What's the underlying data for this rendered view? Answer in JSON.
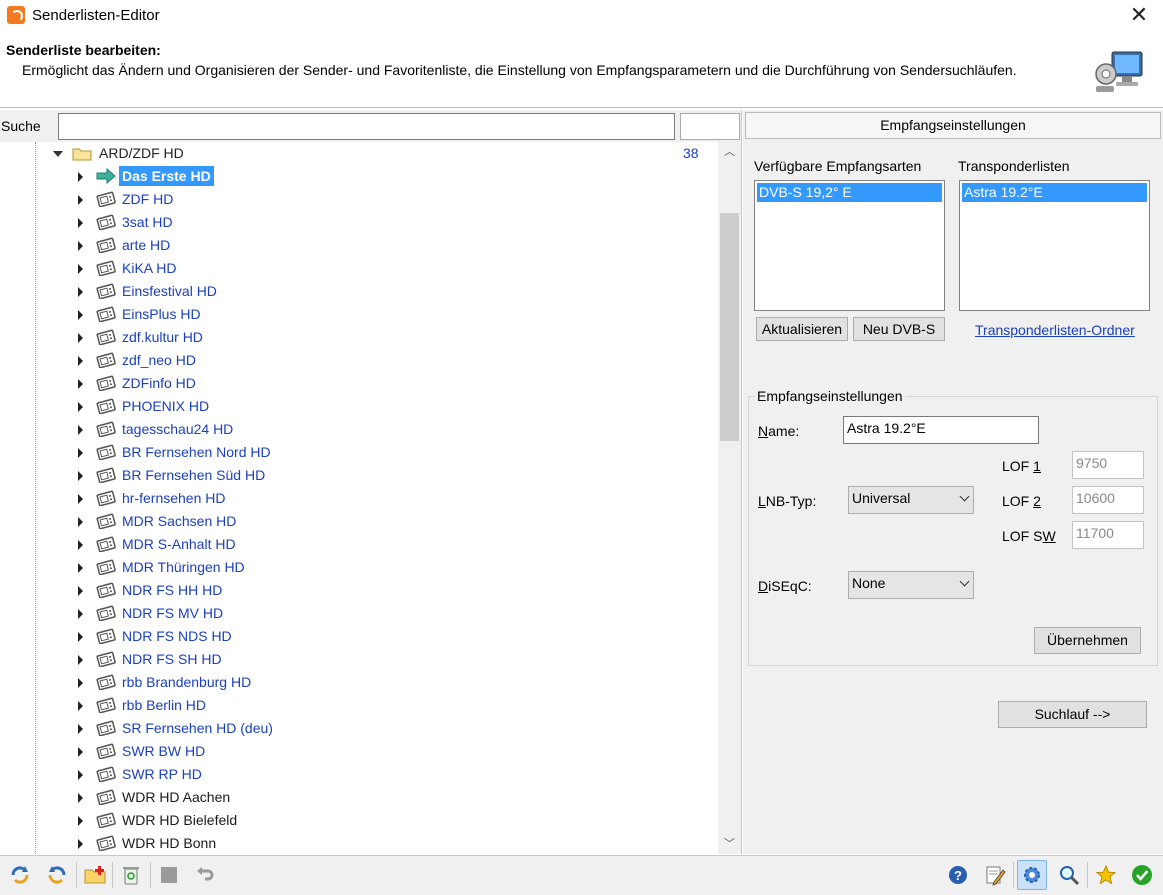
{
  "window": {
    "title": "Senderlisten-Editor",
    "close": "✕"
  },
  "header": {
    "title": "Senderliste bearbeiten:",
    "description": "Ermöglicht das Ändern und Organisieren der Sender- und Favoritenliste, die Einstellung von Empfangsparametern und die Durchführung von Sendersuchläufen."
  },
  "search": {
    "label": "Suche",
    "value": ""
  },
  "tree": {
    "folder": {
      "label": "ARD/ZDF HD",
      "count": "38"
    },
    "channels": [
      {
        "label": "Das Erste HD",
        "selected": true,
        "color": "blue"
      },
      {
        "label": "ZDF HD",
        "color": "blue"
      },
      {
        "label": "3sat HD",
        "color": "blue"
      },
      {
        "label": "arte HD",
        "color": "blue"
      },
      {
        "label": "KiKA HD",
        "color": "blue"
      },
      {
        "label": "Einsfestival HD",
        "color": "blue"
      },
      {
        "label": "EinsPlus HD",
        "color": "blue"
      },
      {
        "label": "zdf.kultur HD",
        "color": "blue"
      },
      {
        "label": "zdf_neo HD",
        "color": "blue"
      },
      {
        "label": "ZDFinfo HD",
        "color": "blue"
      },
      {
        "label": "PHOENIX HD",
        "color": "blue"
      },
      {
        "label": "tagesschau24 HD",
        "color": "blue"
      },
      {
        "label": "BR Fernsehen Nord HD",
        "color": "blue"
      },
      {
        "label": "BR Fernsehen Süd HD",
        "color": "blue"
      },
      {
        "label": "hr-fernsehen HD",
        "color": "blue"
      },
      {
        "label": "MDR Sachsen HD",
        "color": "blue"
      },
      {
        "label": "MDR S-Anhalt HD",
        "color": "blue"
      },
      {
        "label": "MDR Thüringen HD",
        "color": "blue"
      },
      {
        "label": "NDR FS HH HD",
        "color": "blue"
      },
      {
        "label": "NDR FS MV HD",
        "color": "blue"
      },
      {
        "label": "NDR FS NDS HD",
        "color": "blue"
      },
      {
        "label": "NDR FS SH HD",
        "color": "blue"
      },
      {
        "label": "rbb Brandenburg HD",
        "color": "blue"
      },
      {
        "label": "rbb Berlin HD",
        "color": "blue"
      },
      {
        "label": "SR Fernsehen HD (deu)",
        "color": "blue"
      },
      {
        "label": "SWR BW HD",
        "color": "blue"
      },
      {
        "label": "SWR RP HD",
        "color": "blue"
      },
      {
        "label": "WDR HD Aachen",
        "color": "black"
      },
      {
        "label": "WDR HD Bielefeld",
        "color": "black"
      },
      {
        "label": "WDR HD Bonn",
        "color": "black"
      }
    ]
  },
  "right": {
    "header": "Empfangseinstellungen",
    "available_label": "Verfügbare Empfangsarten",
    "available_items": [
      "DVB-S 19,2° E"
    ],
    "transponder_label": "Transponderlisten",
    "transponder_items": [
      "Astra 19.2°E"
    ],
    "refresh_button": "Aktualisieren",
    "new_button": "Neu DVB-S",
    "transponder_folder_link": "Transponderlisten-Ordner",
    "group_title": "Empfangseinstellungen",
    "name_label_pre": "",
    "name_label_u": "N",
    "name_label_post": "ame:",
    "name_value": "Astra 19.2°E",
    "lnb_label_pre": "",
    "lnb_label_u": "L",
    "lnb_label_post": "NB-Typ:",
    "lnb_value": "Universal",
    "lof1_label_pre": "LOF ",
    "lof1_label_u": "1",
    "lof1_value": "9750",
    "lof2_label_pre": "LOF ",
    "lof2_label_u": "2",
    "lof2_value": "10600",
    "lofsw_label_pre": "LOF S",
    "lofsw_label_u": "W",
    "lofsw_value": "11700",
    "diseqc_label_pre": "",
    "diseqc_label_u": "D",
    "diseqc_label_post": "iSEqC:",
    "diseqc_value": "None",
    "apply_button": "Übernehmen",
    "scan_button": "Suchlauf -->"
  },
  "colors": {
    "selection": "#3399ff",
    "link": "#1a3fbf",
    "panel": "#f0f0f0"
  }
}
